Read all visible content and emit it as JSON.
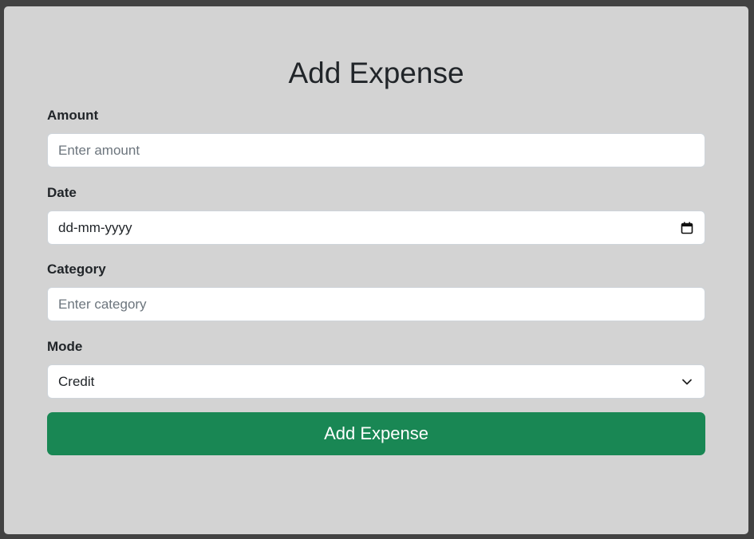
{
  "form": {
    "title": "Add Expense",
    "amount": {
      "label": "Amount",
      "placeholder": "Enter amount",
      "value": ""
    },
    "date": {
      "label": "Date",
      "value": "dd-mm-yyyy",
      "icon": "calendar-icon"
    },
    "category": {
      "label": "Category",
      "placeholder": "Enter category",
      "value": ""
    },
    "mode": {
      "label": "Mode",
      "selected": "Credit",
      "icon": "chevron-down-icon"
    },
    "submit_label": "Add Expense"
  },
  "colors": {
    "page_background": "#424242",
    "card_background": "#d3d3d3",
    "submit_button": "#198754",
    "text": "#212529"
  }
}
